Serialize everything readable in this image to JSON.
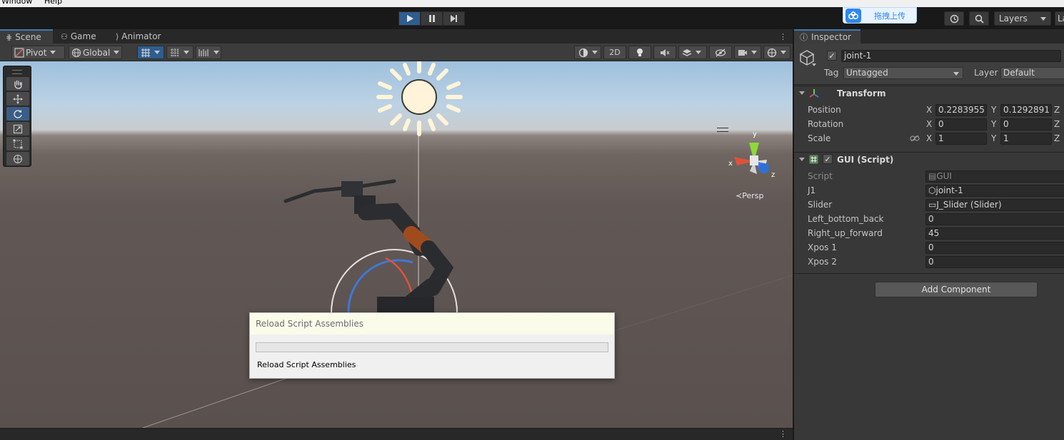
{
  "menu": {
    "window": "Window",
    "help": "Help"
  },
  "toolbar": {
    "cloud_label": "拖拽上传",
    "layers_label": "Layers",
    "layout_label": "La"
  },
  "scene_tabs": [
    {
      "label": "Scene",
      "icon": "grid-icon"
    },
    {
      "label": "Game",
      "icon": "gamepad-icon"
    },
    {
      "label": "Animator",
      "icon": "animator-icon"
    }
  ],
  "scene_toolbar": {
    "pivot": "Pivot",
    "global": "Global",
    "mode_2d": "2D"
  },
  "viewport": {
    "persp_label": "≺Persp",
    "axis_y": "y",
    "axis_x": "x",
    "axis_z": "z"
  },
  "dialog": {
    "title": "Reload Script Assemblies",
    "message": "Reload Script Assemblies",
    "progress": 0
  },
  "inspector": {
    "tab_label": "Inspector",
    "object_name": "joint-1",
    "tag_label": "Tag",
    "tag_value": "Untagged",
    "layer_label": "Layer",
    "layer_value": "Default",
    "transform": {
      "title": "Transform",
      "position": {
        "label": "Position",
        "x": "0.2283955",
        "y": "0.1292891"
      },
      "rotation": {
        "label": "Rotation",
        "x": "0",
        "y": "0"
      },
      "scale": {
        "label": "Scale",
        "x": "1",
        "y": "1"
      },
      "axis_x": "X",
      "axis_y": "Y",
      "axis_z": "Z"
    },
    "gui_script": {
      "title": "GUI (Script)",
      "fields": [
        {
          "label": "Script",
          "value": "GUI",
          "icon": "script-icon",
          "dim": true
        },
        {
          "label": "J1",
          "value": "joint-1",
          "icon": "gameobject-icon"
        },
        {
          "label": "Slider",
          "value": "J_Slider (Slider)",
          "icon": "slider-icon"
        },
        {
          "label": "Left_bottom_back",
          "value": "0"
        },
        {
          "label": "Right_up_forward",
          "value": "45"
        },
        {
          "label": "Xpos 1",
          "value": "0"
        },
        {
          "label": "Xpos 2",
          "value": "0"
        }
      ]
    },
    "add_component": "Add Component"
  }
}
